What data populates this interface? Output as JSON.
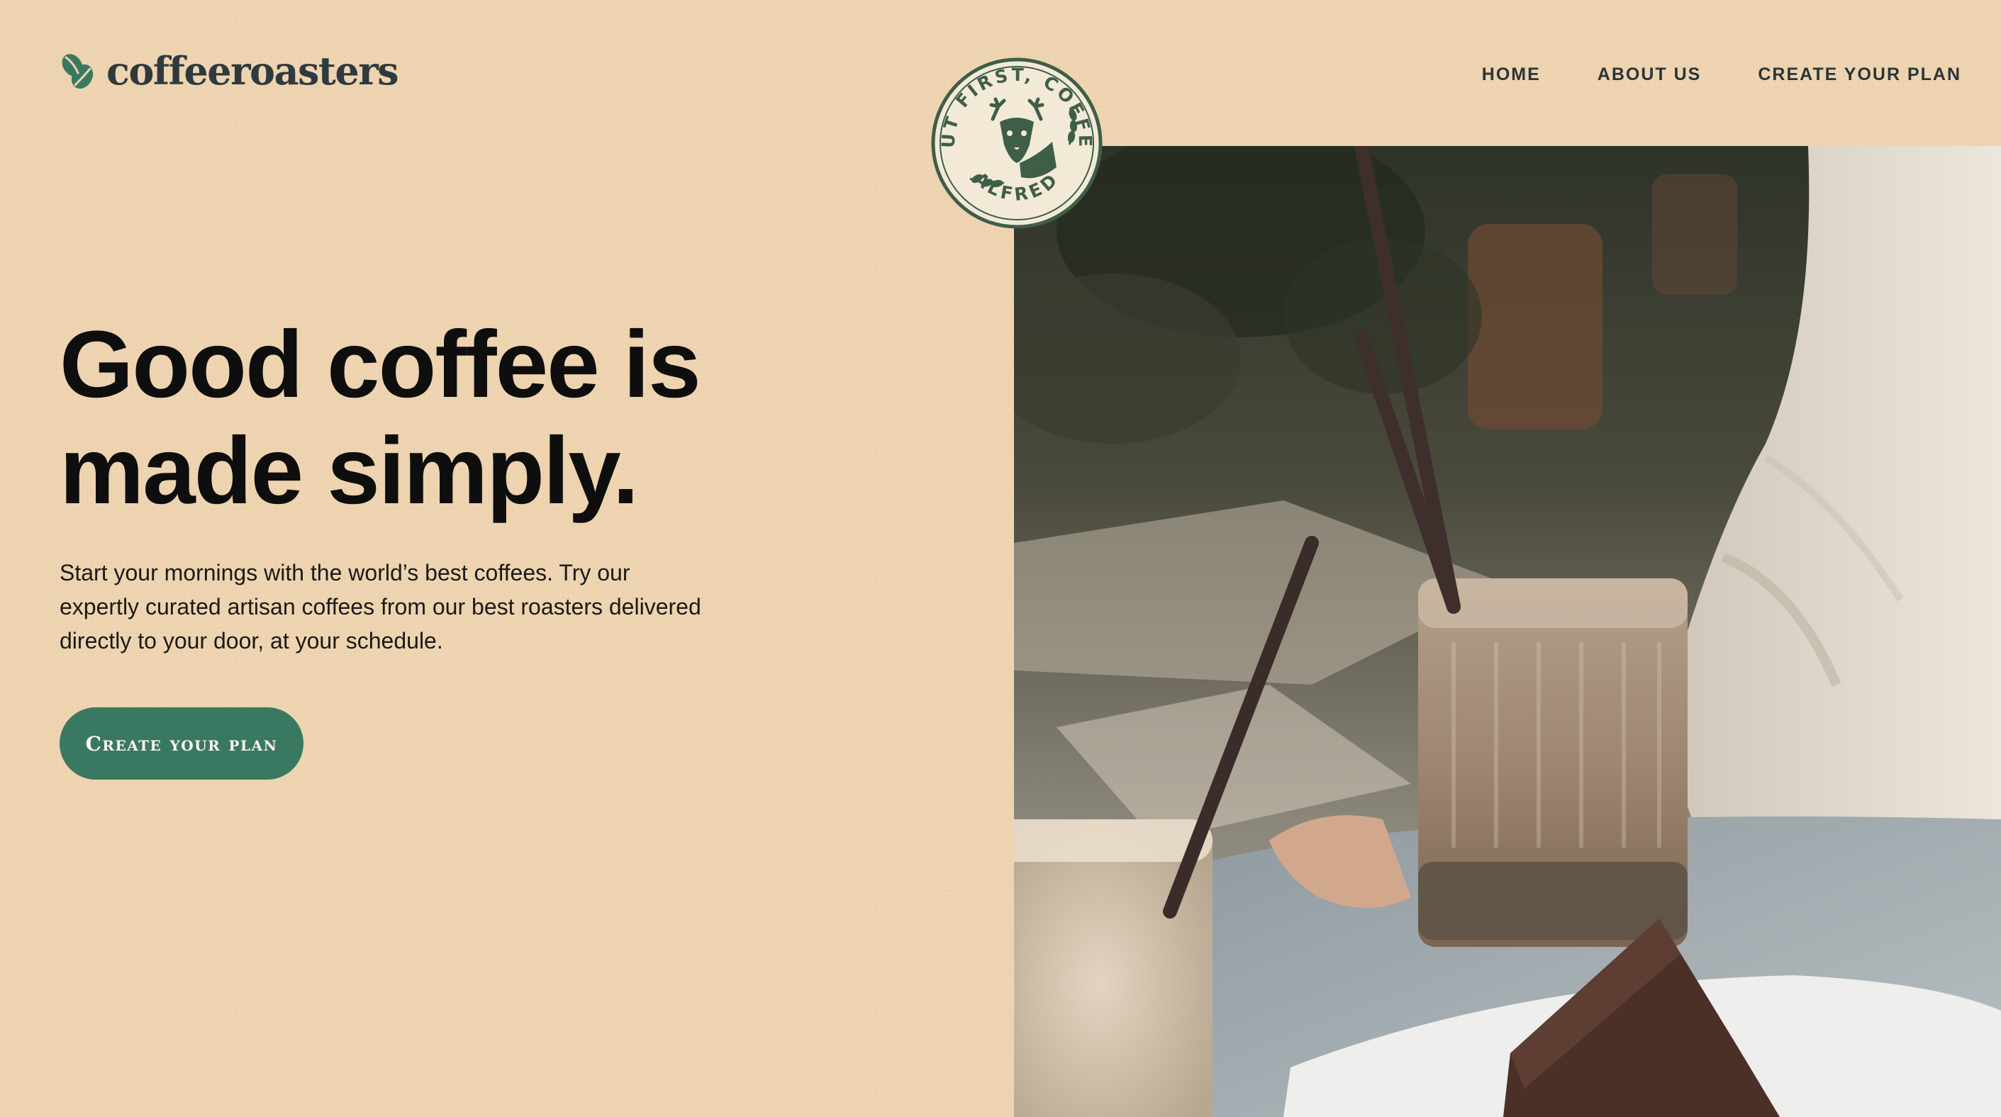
{
  "brand": {
    "name": "coffeeroasters",
    "logo_icon": "coffee-bean-icon",
    "accent_color": "#3a7961",
    "background_color": "#eed4b0"
  },
  "nav": {
    "items": [
      {
        "label": "HOME"
      },
      {
        "label": "ABOUT US"
      },
      {
        "label": "CREATE YOUR PLAN"
      }
    ]
  },
  "badge": {
    "top_text": "BUT FIRST, COFFEE",
    "bottom_text": "ALFRED",
    "icon": "deer-mascot-icon"
  },
  "hero": {
    "title_lines": [
      "Good coffee is",
      "made simply."
    ],
    "body_lines": [
      "Start your mornings with the world’s best coffees. Try our",
      "expertly curated artisan coffees from our best roasters delivered",
      "directly to your door, at your schedule."
    ],
    "cta_label": "Create your plan",
    "image": "iced-coffee-and-brownie-photo"
  }
}
